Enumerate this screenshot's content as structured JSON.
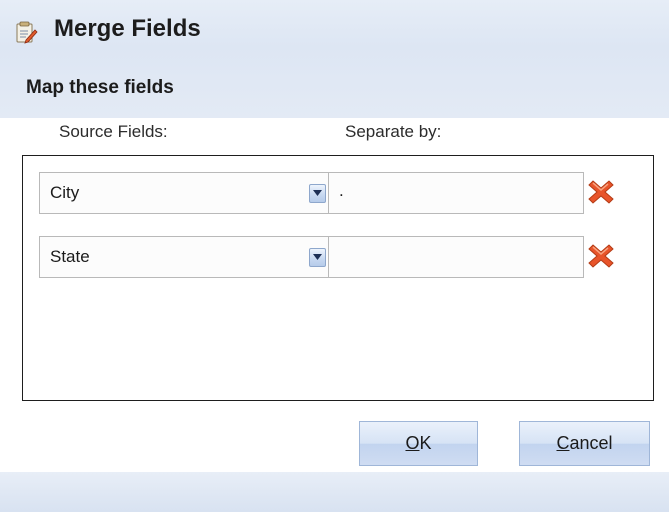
{
  "window": {
    "title": "Merge Fields",
    "icon": "merge-fields-icon"
  },
  "section": {
    "title": "Map these fields"
  },
  "columns": {
    "source": "Source Fields:",
    "separator": "Separate by:"
  },
  "rows": [
    {
      "source_value": "City",
      "separator_value": "."
    },
    {
      "source_value": "State",
      "separator_value": ""
    }
  ],
  "buttons": {
    "ok_mnemonic": "O",
    "ok_rest": "K",
    "cancel_mnemonic": "C",
    "cancel_rest": "ancel"
  },
  "colors": {
    "header_bg": "#dde6f3",
    "remove_icon": "#e8542a",
    "button_border": "#9fb6d8"
  }
}
